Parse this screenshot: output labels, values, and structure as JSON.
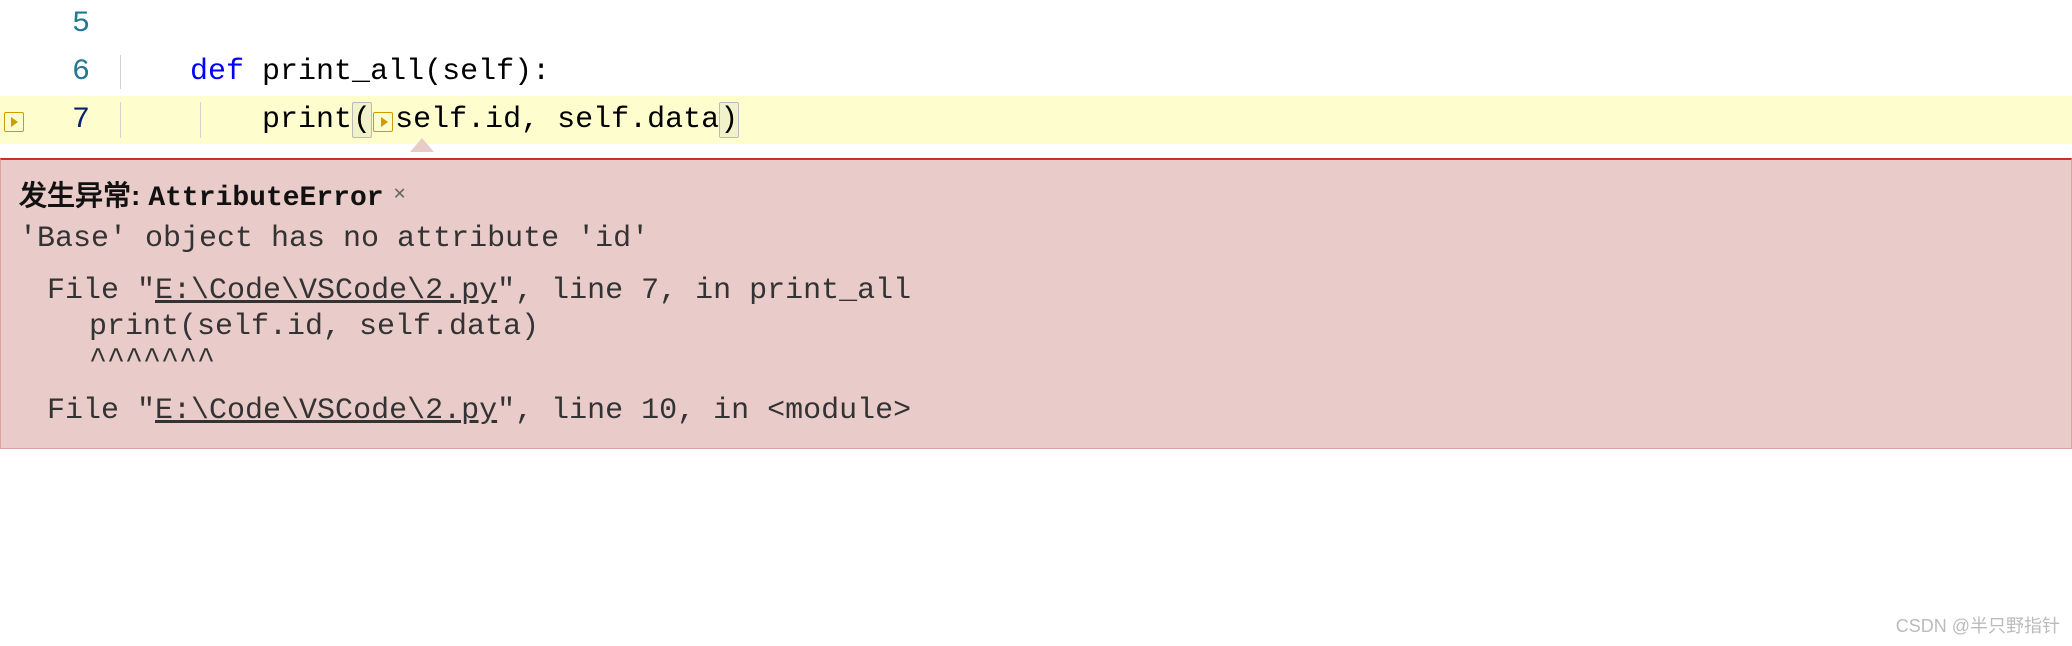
{
  "editor": {
    "lines": [
      {
        "num": "5",
        "indent": 0,
        "tokens": []
      },
      {
        "num": "6",
        "indent": 1,
        "tokens": [
          {
            "t": "kw",
            "v": "def"
          },
          {
            "t": "sp",
            "v": " "
          },
          {
            "t": "fn",
            "v": "print_all"
          },
          {
            "t": "punct",
            "v": "("
          },
          {
            "t": "param",
            "v": "self"
          },
          {
            "t": "punct",
            "v": "):"
          }
        ]
      },
      {
        "num": "7",
        "indent": 2,
        "highlighted": true,
        "gutter_icon": true,
        "tokens": [
          {
            "t": "call",
            "v": "print"
          },
          {
            "t": "paren",
            "v": "("
          },
          {
            "t": "inline-play",
            "v": ""
          },
          {
            "t": "param",
            "v": "self"
          },
          {
            "t": "punct",
            "v": "."
          },
          {
            "t": "param",
            "v": "id"
          },
          {
            "t": "punct",
            "v": ","
          },
          {
            "t": "sp",
            "v": " "
          },
          {
            "t": "param",
            "v": "self"
          },
          {
            "t": "punct",
            "v": "."
          },
          {
            "t": "param",
            "v": "data"
          },
          {
            "t": "paren",
            "v": ")"
          }
        ]
      }
    ]
  },
  "exception": {
    "title_prefix": "发生异常:",
    "title_name": "AttributeError",
    "message": "'Base' object has no attribute 'id'",
    "frames": [
      {
        "file_prefix": "  File \"",
        "file": "E:\\Code\\VSCode\\2.py",
        "file_suffix": "\", line 7, in print_all",
        "code": "    print(self.id, self.data)",
        "caret": "          ^^^^^^^"
      },
      {
        "file_prefix": "  File \"",
        "file": "E:\\Code\\VSCode\\2.py",
        "file_suffix": "\", line 10, in <module>"
      }
    ]
  },
  "watermark": "CSDN @半只野指针"
}
